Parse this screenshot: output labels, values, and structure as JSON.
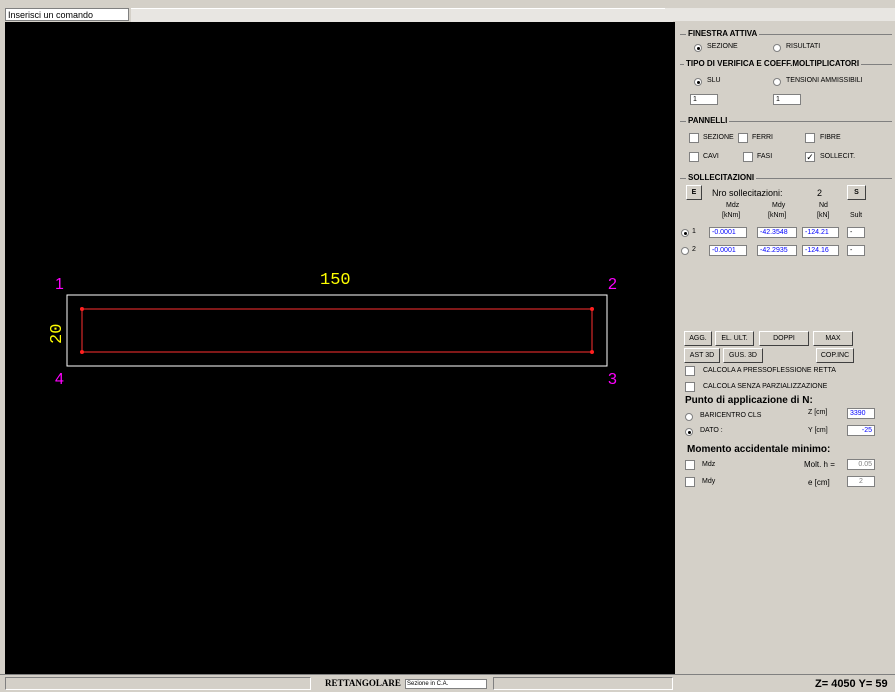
{
  "command": {
    "placeholder": "Inserisci un comando"
  },
  "drawing": {
    "dim_width": "150",
    "dim_height": "20",
    "corners": [
      "1",
      "2",
      "3",
      "4"
    ],
    "colors": {
      "dim": "#ffff00",
      "corner": "#ff00ff",
      "outline": "#ffffff",
      "inner": "#ff0000"
    }
  },
  "panel": {
    "finestra": {
      "title": "FINESTRA ATTIVA",
      "options": [
        "SEZIONE",
        "RISULTATI"
      ],
      "selected": "SEZIONE"
    },
    "verifica": {
      "title": "TIPO DI VERIFICA E COEFF.MOLTIPLICATORI",
      "options": [
        "SLU",
        "TENSIONI AMMISSIBILI"
      ],
      "selected": "SLU",
      "values": [
        "1",
        "1"
      ]
    },
    "pannelli": {
      "title": "PANNELLI",
      "items": [
        {
          "label": "SEZIONE",
          "checked": false
        },
        {
          "label": "FERRI",
          "checked": false
        },
        {
          "label": "FIBRE",
          "checked": false
        },
        {
          "label": "CAVI",
          "checked": false
        },
        {
          "label": "FASI",
          "checked": false
        },
        {
          "label": "SOLLECIT.",
          "checked": true
        }
      ]
    },
    "sollecitazioni": {
      "title": "SOLLECITAZIONI",
      "btn_e": "E",
      "btn_s": "S",
      "count_label": "Nro sollecitazioni:",
      "count": "2",
      "headers": [
        {
          "name": "Mdz",
          "unit": "[kNm]"
        },
        {
          "name": "Mdy",
          "unit": "[kNm]"
        },
        {
          "name": "Nd",
          "unit": "[kN]"
        },
        {
          "name": "Sult",
          "unit": ""
        }
      ],
      "rows": [
        {
          "index": "1",
          "selected": true,
          "mdz": "-0.0001",
          "mdy": "-42.3548",
          "nd": "-124.21",
          "sult": "-"
        },
        {
          "index": "2",
          "selected": false,
          "mdz": "-0.0001",
          "mdy": "-42.2935",
          "nd": "-124.16",
          "sult": "-"
        }
      ]
    },
    "buttons_row1": [
      "AGG.",
      "EL. ULT.",
      "DOPPI",
      "MAX"
    ],
    "buttons_row2": [
      "AST 3D",
      "GUS. 3D",
      "COP.INC"
    ],
    "options": [
      {
        "label": "CALCOLA A PRESSOFLESSIONE RETTA",
        "checked": false
      },
      {
        "label": "CALCOLA SENZA PARZIALIZZAZIONE",
        "checked": false
      }
    ],
    "punto": {
      "title": "Punto di applicazione di N:",
      "opt_baricentro": "BARICENTRO CLS",
      "opt_dato": "DATO :",
      "selected": "DATO :",
      "z_label": "Z [cm]",
      "z_value": "3390",
      "y_label": "Y [cm]",
      "y_value": "-25"
    },
    "momento": {
      "title": "Momento accidentale minimo:",
      "mdz": "Mdz",
      "mdy": "Mdy",
      "molt_label": "Molt. h =",
      "molt_value": "0.05",
      "e_label": "e [cm]",
      "e_value": "2"
    }
  },
  "status": {
    "shape": "RETTANGOLARE",
    "section_type": "Sezione in C.A.",
    "coords": "Z= 4050 Y= 59"
  }
}
